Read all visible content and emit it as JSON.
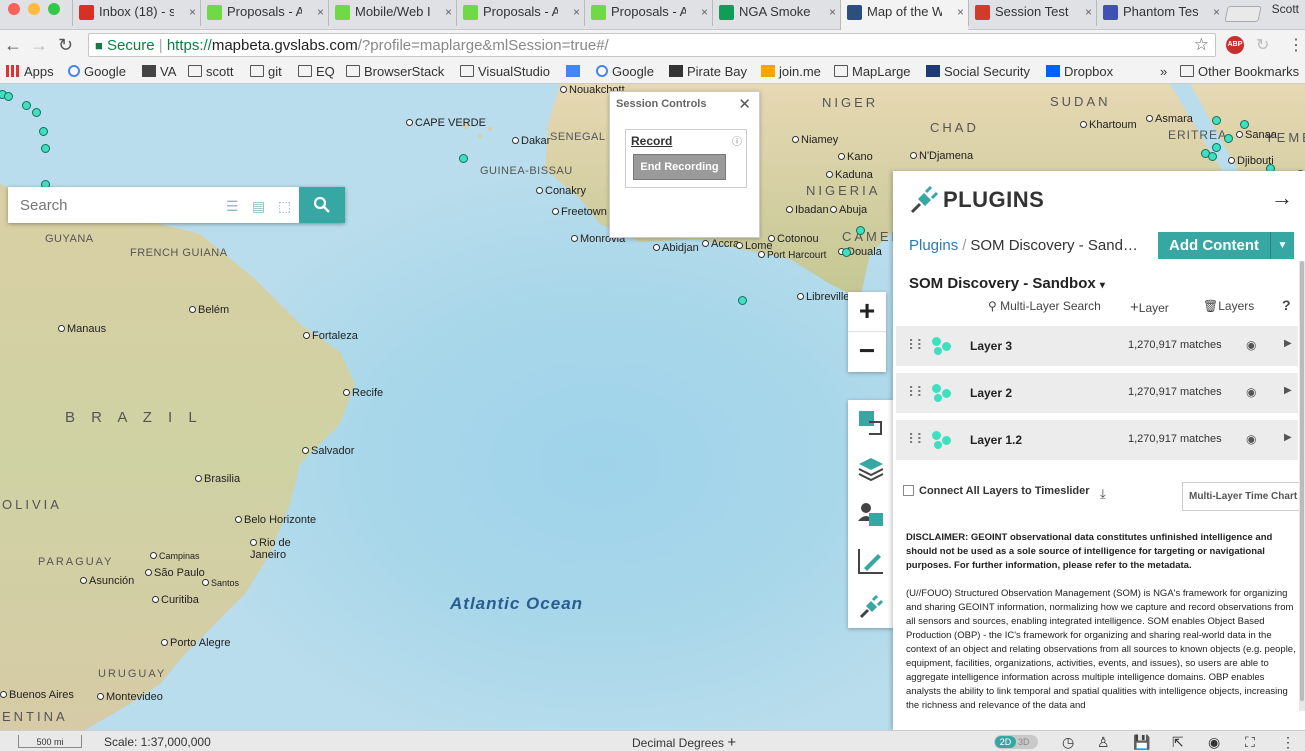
{
  "browser": {
    "profile_name": "Scott",
    "tabs": [
      {
        "label": "Inbox (18) - s",
        "favicon": "gmail-icon",
        "color": "#d93025"
      },
      {
        "label": "Proposals - A",
        "favicon": "upwork-icon",
        "color": "#6fda44"
      },
      {
        "label": "Mobile/Web I",
        "favicon": "upwork-icon",
        "color": "#6fda44"
      },
      {
        "label": "Proposals - A",
        "favicon": "upwork-icon",
        "color": "#6fda44"
      },
      {
        "label": "Proposals - A",
        "favicon": "upwork-icon",
        "color": "#6fda44"
      },
      {
        "label": "NGA Smoke",
        "favicon": "sheets-icon",
        "color": "#0f9d58"
      },
      {
        "label": "Map of the W",
        "favicon": "globe-icon",
        "color": "#2d4f7c"
      },
      {
        "label": "Session Test",
        "favicon": "clapper-icon",
        "color": "#d23a2a"
      },
      {
        "label": "Phantom Tes",
        "favicon": "phantom-icon",
        "color": "#3f51b5"
      }
    ],
    "secure_label": "Secure",
    "url_scheme": "https://",
    "url_host": "mapbeta.gvslabs.com",
    "url_rest": "/?profile=maplarge&mlSession=true#/",
    "bookmarks": [
      {
        "label": "Apps",
        "icon": "apps-icon"
      },
      {
        "label": "Google",
        "icon": "google-icon"
      },
      {
        "label": "VA",
        "icon": "va-icon"
      },
      {
        "label": "scott",
        "icon": "folder-icon"
      },
      {
        "label": "git",
        "icon": "folder-icon"
      },
      {
        "label": "EQ",
        "icon": "folder-icon"
      },
      {
        "label": "BrowserStack",
        "icon": "folder-icon"
      },
      {
        "label": "VisualStudio",
        "icon": "folder-icon"
      },
      {
        "label": "",
        "icon": "docs-icon"
      },
      {
        "label": "Google",
        "icon": "google-icon"
      },
      {
        "label": "Pirate Bay",
        "icon": "pirate-icon"
      },
      {
        "label": "join.me",
        "icon": "joinme-icon"
      },
      {
        "label": "MapLarge",
        "icon": "folder-icon"
      },
      {
        "label": "Social Security",
        "icon": "ssa-icon"
      },
      {
        "label": "Dropbox",
        "icon": "dropbox-icon"
      }
    ],
    "bookmarks_overflow": "»",
    "other_bookmarks": "Other Bookmarks"
  },
  "map": {
    "ocean_label": "Atlantic Ocean",
    "countries": [
      "NIGER",
      "CHAD",
      "SUDAN",
      "NIGERIA",
      "B R A Z I L",
      "OLIVIA",
      "PARAGUAY",
      "URUGUAY",
      "ENTINA",
      "GUYANA",
      "FRENCH GUIANA",
      "SENEGAL",
      "GUINEA-BISSAU",
      "CAMEROO",
      "ERITREA",
      "YEME"
    ],
    "cities": [
      "Nouakchott",
      "CAPE VERDE",
      "Dakar",
      "Conakry",
      "Freetown",
      "Monrovia",
      "Abidjan",
      "Accra",
      "Lome",
      "Cotonou",
      "Niamey",
      "Kano",
      "Kaduna",
      "Abuja",
      "Ibadan",
      "Port Harcourt",
      "Douala",
      "Libreville",
      "N'Djamena",
      "Khartoum",
      "Asmara",
      "Sanaa",
      "Djibouti",
      "Belém",
      "Manaus",
      "Fortaleza",
      "Recife",
      "Salvador",
      "Brasilia",
      "Belo Horizonte",
      "Rio de Janeiro",
      "Campinas",
      "São Paulo",
      "Santos",
      "Curitiba",
      "Asunción",
      "Porto Alegre",
      "Buenos Aires",
      "Montevideo"
    ]
  },
  "search": {
    "placeholder": "Search"
  },
  "session": {
    "title": "Session Controls",
    "record_label": "Record",
    "end_button": "End Recording"
  },
  "zoom": {
    "in": "+",
    "out": "−"
  },
  "tools": [
    {
      "name": "basemap-tool",
      "icon": "square-select-icon"
    },
    {
      "name": "layers-tool",
      "icon": "layers-icon"
    },
    {
      "name": "user-tool",
      "icon": "user-card-icon"
    },
    {
      "name": "draw-tool",
      "icon": "draw-chart-icon"
    },
    {
      "name": "plugins-tool",
      "icon": "plug-icon"
    }
  ],
  "panel": {
    "title": "PLUGINS",
    "breadcrumb_root": "Plugins",
    "breadcrumb_sep": "/",
    "breadcrumb_current": "SOM Discovery - Sand…",
    "add_content": "Add Content",
    "group_title": "SOM Discovery - Sandbox",
    "actions": {
      "multi_layer_search": "Multi-Layer Search",
      "layer": "Layer",
      "layers": "Layers",
      "help": "?"
    },
    "layers": [
      {
        "name": "Layer 3",
        "count": "1,270,917 matches"
      },
      {
        "name": "Layer 2",
        "count": "1,270,917 matches"
      },
      {
        "name": "Layer 1.2",
        "count": "1,270,917 matches"
      }
    ],
    "timeslider_label": "Connect All Layers to Timeslider",
    "multi_chart_label": "Multi-Layer Time Chart",
    "disclaimer_bold": "DISCLAIMER: GEOINT observational data constitutes unfinished intelligence and should not be used as a sole source of intelligence for targeting or navigational purposes. For further information, please refer to the metadata.",
    "disclaimer_body": "(U//FOUO) Structured Observation Management (SOM) is NGA's framework for organizing and sharing GEOINT information, normalizing how we capture and record observations from all sensors and sources, enabling integrated intelligence. SOM enables Object Based Production (OBP) - the IC's framework for organizing and sharing real-world data in the context of an object and relating observations from all sources to known objects (e.g. people, equipment, facilities, organizations, activities, events, and issues), so users are able to aggregate intelligence information across multiple intelligence domains. OBP enables analysts the ability to link temporal and spatial qualities with intelligence objects, increasing the richness and relevance of the data and"
  },
  "statusbar": {
    "scale_bar_label": "500 mi",
    "scale_text": "Scale: 1:37,000,000",
    "coord_mode": "Decimal Degrees",
    "dim_2d": "2D",
    "dim_3d": "3D"
  },
  "colors": {
    "accent": "#36a7a3",
    "point": "#3fe0c0",
    "link": "#2a7ab8"
  }
}
